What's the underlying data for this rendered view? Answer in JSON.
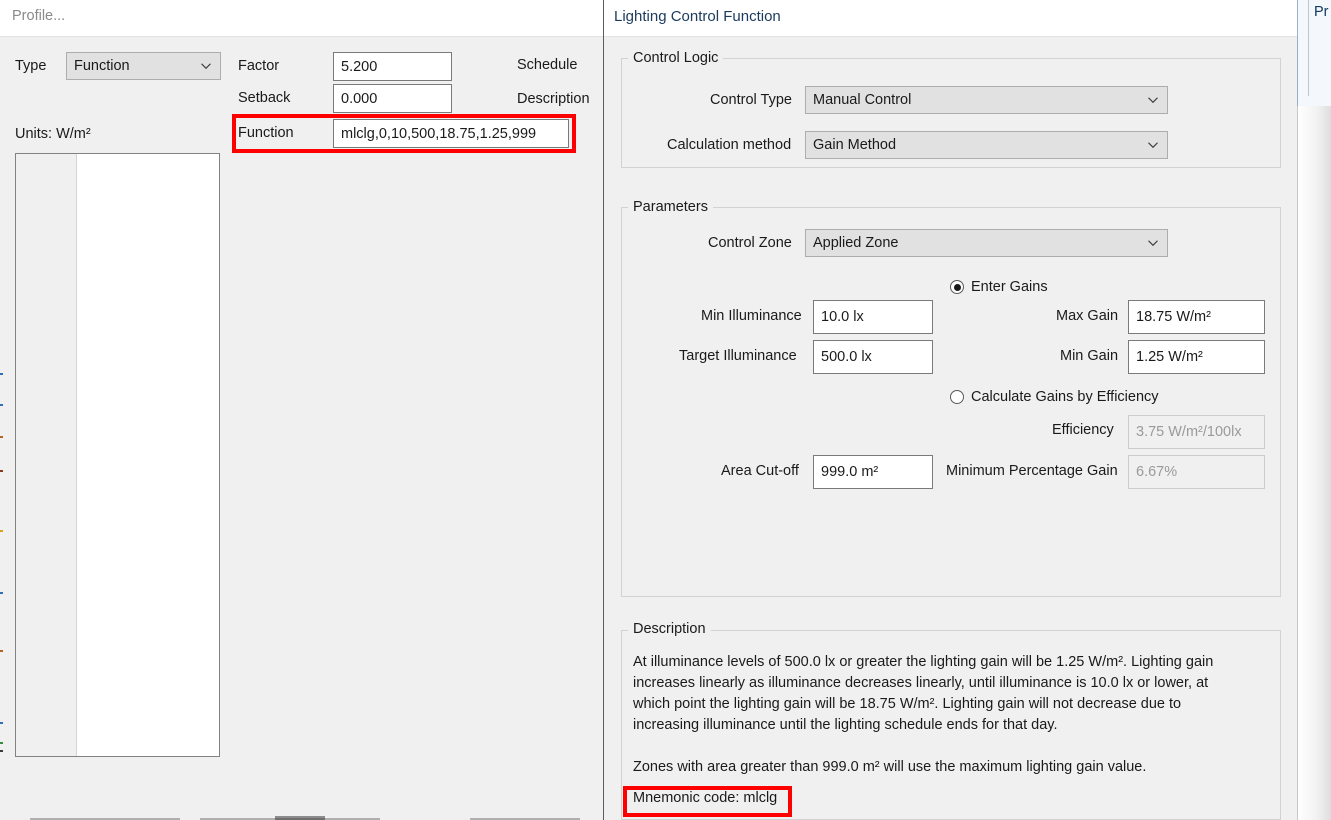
{
  "background_window": {
    "profile_panel": {
      "title": "Profile...",
      "type_label": "Type",
      "type_value": "Function",
      "units_label": "Units: W/m²",
      "factor_label": "Factor",
      "factor_value": "5.200",
      "setback_label": "Setback",
      "setback_value": "0.000",
      "function_label": "Function",
      "function_value": "mlclg,0,10,500,18.75,1.25,999",
      "schedule_label": "Schedule",
      "description_label": "Description"
    },
    "right_partial_panel": {
      "label": "Pr"
    }
  },
  "dialog": {
    "title": "Lighting Control Function",
    "control_logic": {
      "group_title": "Control Logic",
      "control_type_label": "Control Type",
      "control_type_value": "Manual Control",
      "calculation_method_label": "Calculation method",
      "calculation_method_value": "Gain Method"
    },
    "parameters": {
      "group_title": "Parameters",
      "control_zone_label": "Control Zone",
      "control_zone_value": "Applied Zone",
      "enter_gains_radio_label": "Enter Gains",
      "calculate_gains_radio_label": "Calculate Gains by Efficiency",
      "min_illuminance_label": "Min Illuminance",
      "min_illuminance_value": "10.0 lx",
      "target_illuminance_label": "Target Illuminance",
      "target_illuminance_value": "500.0 lx",
      "max_gain_label": "Max Gain",
      "max_gain_value": "18.75 W/m²",
      "min_gain_label": "Min Gain",
      "min_gain_value": "1.25 W/m²",
      "efficiency_label": "Efficiency",
      "efficiency_value": "3.75 W/m²/100lx",
      "area_cutoff_label": "Area Cut-off",
      "area_cutoff_value": "999.0 m²",
      "minimum_percentage_gain_label": "Minimum Percentage Gain",
      "minimum_percentage_gain_value": "6.67%"
    },
    "description": {
      "group_title": "Description",
      "paragraph_1": "At illuminance levels of 500.0 lx or greater the lighting gain will be 1.25 W/m². Lighting gain increases linearly as illuminance decreases linearly, until illuminance is 10.0 lx or lower, at which point the lighting gain will be 18.75 W/m². Lighting gain will not decrease due to increasing illuminance until the lighting schedule ends for that day.",
      "paragraph_2": "Zones with area greater than 999.0 m² will use the maximum lighting gain value.",
      "mnemonic_text": "Mnemonic code: mlclg"
    }
  },
  "annotations": {
    "highlight_color": "#ff0000",
    "highlight_1_target": "function-field-row",
    "highlight_2_target": "mnemonic-code-text"
  }
}
